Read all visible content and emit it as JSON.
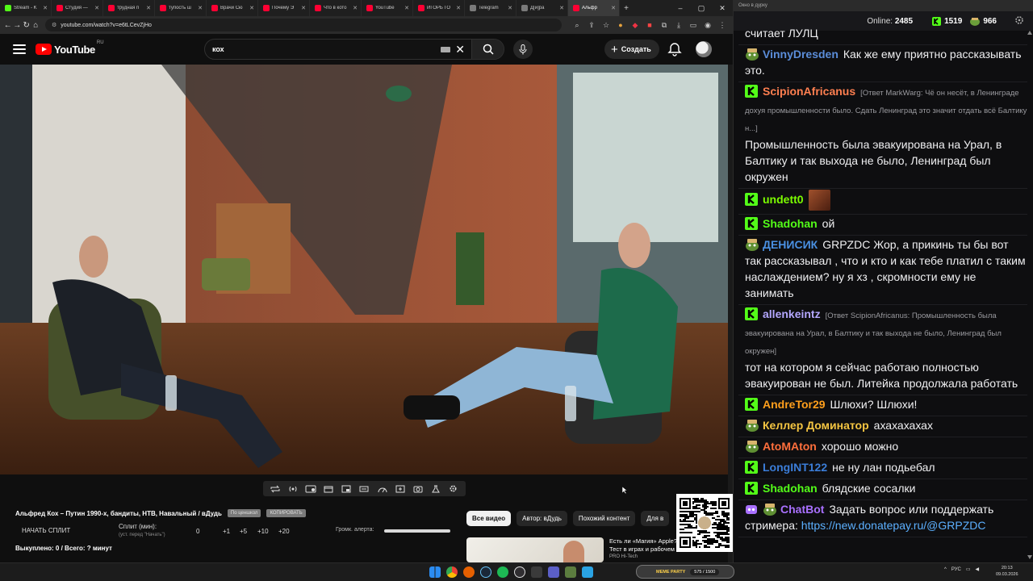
{
  "browser": {
    "tabs": [
      {
        "label": "Stream - K",
        "color": "#53fc18"
      },
      {
        "label": "Студия —",
        "color": "#ff0033"
      },
      {
        "label": "трудная п",
        "color": "#ff0033"
      },
      {
        "label": "тупость ш",
        "color": "#ff0033"
      },
      {
        "label": "Врачи Сю",
        "color": "#ff0033"
      },
      {
        "label": "Почему Э",
        "color": "#ff0033"
      },
      {
        "label": "Что в кото",
        "color": "#ff0033"
      },
      {
        "label": "YouTube",
        "color": "#ff0033"
      },
      {
        "label": "ИГОРЬ ГО",
        "color": "#ff0033"
      },
      {
        "label": "Telegram",
        "color": "#7a7a7a"
      },
      {
        "label": "Д[и]ра",
        "color": "#7a7a7a"
      },
      {
        "label": "Альфр",
        "color": "#ff0033"
      }
    ],
    "url": "youtube.com/watch?v=e6tLCevZjHo"
  },
  "youtube": {
    "logo_text": "YouTube",
    "region": "RU",
    "search_value": "кох",
    "create_label": "Создать"
  },
  "video": {
    "title": "Альфред Кох – Путин 1990-х, бандиты, НТВ, Навальный / вДудь",
    "pill_sub": "По ценшкол",
    "pill_copy": "КОПИРОВАТЬ"
  },
  "split": {
    "start_label": "НАЧАТЬ СПЛИТ",
    "split_label": "Сплит (мин):",
    "split_hint": "(уст. перед \"Начать\")",
    "values": [
      "0",
      "+1",
      "+5",
      "+10",
      "+20"
    ],
    "volume_label": "Громк. алерта:",
    "volume_level": 1.0,
    "bought": "Выкуплено: 0 / Всего: ? минут"
  },
  "chips": [
    "Все видео",
    "Автор: вДудь",
    "Похожий контент",
    "Для в"
  ],
  "recommendation": {
    "title_line1": "Есть ли «Магия» Apple?",
    "title_line2": "Тест в играх и рабочем П...",
    "channel": "PRO Hi-Tech"
  },
  "chat": {
    "window_title": "Окно в дурку",
    "online_label": "Online:",
    "online_count": "2485",
    "stat1": "1519",
    "stat2": "966",
    "messages": [
      {
        "badge": "none",
        "nick": "",
        "nick_color": "#efeff1",
        "reply": "",
        "text": "считает ЛУЛЦ"
      },
      {
        "badge": "pepe",
        "nick": "VinnyDresden",
        "nick_color": "#5b8dd9",
        "reply": "",
        "text": "Как же ему приятно рассказывать это."
      },
      {
        "badge": "kick",
        "nick": "ScipionAfricanus",
        "nick_color": "#ff7f50",
        "reply": "[Ответ MarkWarg: Чё он несёт, в Ленинграде дохуя промышленности было. Сдать Ленинград это значит отдать всё Балтику н...]",
        "text": "Промышленность была эвакуирована на Урал, в Балтику и так выхода не было, Ленинград был окружен"
      },
      {
        "badge": "kick",
        "nick": "undett0",
        "nick_color": "#7cfc00",
        "reply": "",
        "text": "",
        "emote": true
      },
      {
        "badge": "kick",
        "nick": "Shadohan",
        "nick_color": "#53fc18",
        "reply": "",
        "text": "ой"
      },
      {
        "badge": "pepe",
        "nick": "ДЕНИСИК",
        "nick_color": "#4a90e2",
        "reply": "",
        "text": "GRPZDC Жор, а прикинь ты бы вот так рассказывал , что и кто и как тебе платил с таким наслаждением? ну я хз , скромности ему не занимать",
        "mention": "GRPZDC"
      },
      {
        "badge": "kick",
        "nick": "allenkeintz",
        "nick_color": "#b4a7ff",
        "reply": "[Ответ ScipionAfricanus: Промышленность была эвакуирована на Урал, в Балтику и так выхода не было, Ленинград был окружен]",
        "text": "тот на котором я сейчас работаю полностью эвакуирован не был. Литейка продолжала работать"
      },
      {
        "badge": "kick",
        "nick": "AndreTor29",
        "nick_color": "#ff9f1c",
        "reply": "",
        "text": "Шлюхи? Шлюхи!"
      },
      {
        "badge": "pepe",
        "nick": "Келлер Доминатор",
        "nick_color": "#f4c542",
        "reply": "",
        "text": "ахахахахах"
      },
      {
        "badge": "pepe",
        "nick": "AtoMAton",
        "nick_color": "#ff6f3c",
        "reply": "",
        "text": "хорошо можно"
      },
      {
        "badge": "kick",
        "nick": "LongINT122",
        "nick_color": "#3b7dd8",
        "reply": "",
        "text": "не ну лан подьебал"
      },
      {
        "badge": "kick",
        "nick": "Shadohan",
        "nick_color": "#53fc18",
        "reply": "",
        "text": "блядские сосалки"
      },
      {
        "badge": "bot",
        "nick": "ChatBot",
        "nick_color": "#a970ff",
        "reply": "",
        "text": "Задать вопрос или поддержать стримера: ",
        "link": "https://new.donatepay.ru/@GRPZDC"
      }
    ]
  },
  "taskbar": {
    "meme_label": "MEME PARTY",
    "meme_value": "575 / 1500",
    "lang": "РУС",
    "time": "20:13",
    "date": "09.03.2026"
  }
}
